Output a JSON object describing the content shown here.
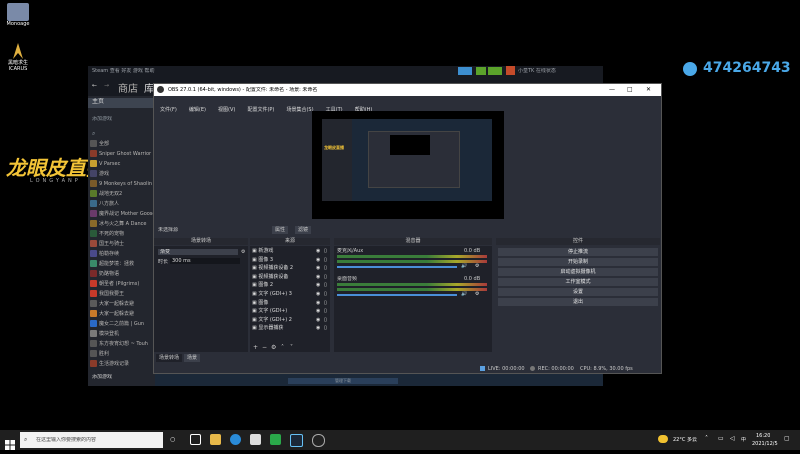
{
  "desktop": {
    "icons": [
      {
        "label": "Monoage"
      },
      {
        "label": "黑暗求生\nICARUS"
      }
    ]
  },
  "watermark": {
    "text": "龙眼皮直播",
    "subtext": "LONGYANP"
  },
  "qq": {
    "number": "474264743"
  },
  "steam": {
    "top_menu": "Steam  查看  好友  游戏  帮助",
    "nav_store": "商店",
    "nav_lib": "库",
    "home": "主页",
    "collections": "添加游戏",
    "user": "小皇TK  在线状态",
    "games": [
      "全部",
      "Sniper Ghost Warrior",
      "V Parsec",
      "游戏",
      "9 Monkeys of Shaolin",
      "战地无双2",
      "八方旅人",
      "魔界战记 Mother Goose",
      "冰与火之舞 A Dance",
      "不死的宠物",
      "国王与骑士",
      "柏勒存续",
      "超能梦境：拯救",
      "奶酪物语",
      "朝圣者 (Pilgrims)",
      "我国我要王",
      "大家一起躲去避",
      "大家一起躲去避",
      "魔女二之前篇 | Gun",
      "模块登机",
      "东方夜宵幻想 ~ Touh",
      "胜利",
      "生活游戏记录"
    ],
    "add_game": "添加游戏",
    "downloads": "管理下载"
  },
  "obs": {
    "title": "OBS 27.0.1 (64-bit, windows) - 配置文件: 未命名 - 场景: 未命名",
    "menu": [
      "文件(F)",
      "编辑(E)",
      "视图(V)",
      "配置文件(P)",
      "场景集合(S)",
      "工具(T)",
      "帮助(H)"
    ],
    "no_source": "未选择源",
    "props_btn": "属性",
    "filter_btn": "滤镜",
    "scenes_title": "场景转场",
    "scene_fade": "渐变",
    "duration_label": "时长",
    "duration_value": "300 ms",
    "sources_title": "来源",
    "sources": [
      "新游戏",
      "图像 3",
      "视频捕获设备 2",
      "视频捕获设备",
      "图像 2",
      "文字 (GDI+) 3",
      "图像",
      "文字 (GDI+)",
      "文字 (GDI+) 2",
      "显示器捕获"
    ],
    "mixer_title": "混音器",
    "mixer_tracks": [
      {
        "name": "麦克风/Aux",
        "db": "0.0 dB"
      },
      {
        "name": "桌面音频",
        "db": "0.0 dB"
      }
    ],
    "controls_title": "控件",
    "controls": [
      "停止推流",
      "开始录制",
      "启动虚拟摄像机",
      "工作室模式",
      "设置",
      "退出"
    ],
    "tabs": [
      "场景转场",
      "场景"
    ],
    "status": {
      "live": "LIVE: 00:00:00",
      "rec": "REC: 00:00:00",
      "cpu": "CPU: 8.9%, 30.00 fps"
    }
  },
  "taskbar": {
    "search_placeholder": "在这里输入你要搜索的内容",
    "temperature": "22°C 多云",
    "time": "16:20",
    "date": "2021/12/5"
  }
}
